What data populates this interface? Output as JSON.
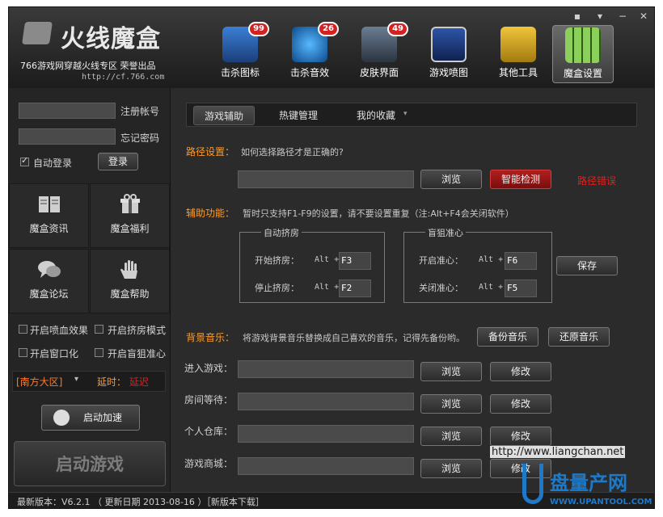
{
  "window": {
    "app_title": "火线魔盒",
    "subtitle": "766游戏网穿越火线专区 荣誉出品",
    "url": "http://cf.766.com"
  },
  "top_nav": [
    {
      "label": "击杀图标",
      "badge": "99",
      "icon": "kill-icon-shield"
    },
    {
      "label": "击杀音效",
      "badge": "26",
      "icon": "music-note-icon"
    },
    {
      "label": "皮肤界面",
      "badge": "49",
      "icon": "skin-character-icon"
    },
    {
      "label": "游戏喷图",
      "badge": "",
      "icon": "spray-mask-icon"
    },
    {
      "label": "其他工具",
      "badge": "",
      "icon": "tools-icon"
    },
    {
      "label": "魔盒设置",
      "badge": "",
      "icon": "settings-grid-icon"
    }
  ],
  "login": {
    "register_link": "注册帐号",
    "forgot_link": "忘记密码",
    "auto_login": "自动登录",
    "login_button": "登录"
  },
  "tiles": [
    {
      "label": "魔盒资讯",
      "icon": "book-icon"
    },
    {
      "label": "魔盒福利",
      "icon": "gift-icon"
    },
    {
      "label": "魔盒论坛",
      "icon": "chat-bubbles-icon"
    },
    {
      "label": "魔盒帮助",
      "icon": "hand-icon"
    }
  ],
  "options": {
    "blood_effect": "开启喷血效果",
    "squeeze_mode": "开启挤房模式",
    "window_mode": "开启窗口化",
    "blind_sniper": "开启盲狙准心"
  },
  "region": {
    "selected": "[南方大区]",
    "latency_label": "延时：",
    "latency_value": "延迟"
  },
  "accelerate_button": "启动加速",
  "start_game_button": "启动游戏",
  "tabs": [
    "游戏辅助",
    "热键管理",
    "我的收藏"
  ],
  "path": {
    "title": "路径设置：",
    "help": "如何选择路径才是正确的?",
    "browse": "浏览",
    "detect": "智能检测",
    "error": "路径错误"
  },
  "assist": {
    "title": "辅助功能：",
    "note": "暂时只支持F1-F9的设置，请不要设置重复（注:Alt+F4会关闭软件）",
    "group_squeeze": "自动挤房",
    "start_squeeze": "开始挤房：",
    "stop_squeeze": "停止挤房：",
    "group_sniper": "盲狙准心",
    "sniper_on": "开启准心：",
    "sniper_off": "关闭准心：",
    "modifier": "Alt +",
    "keys": {
      "start_squeeze": "F3",
      "stop_squeeze": "F2",
      "sniper_on": "F6",
      "sniper_off": "F5"
    },
    "save": "保存"
  },
  "bgm": {
    "title": "背景音乐：",
    "desc": "将游戏背景音乐替换成自己喜欢的音乐，记得先备份哟。",
    "backup": "备份音乐",
    "restore": "还原音乐",
    "rows": [
      {
        "label": "进入游戏："
      },
      {
        "label": "房间等待："
      },
      {
        "label": "个人仓库："
      },
      {
        "label": "游戏商城："
      }
    ],
    "browse": "浏览",
    "modify": "修改"
  },
  "status": {
    "version": "最新版本：V6.2.1 （ 更新日期 2013-08-16 ）［新版本下载］"
  },
  "watermark": {
    "url": "http://www.liangchan.net",
    "brand": "盘量产网",
    "domain": "WWW.UPANTOOL.COM"
  },
  "colors": {
    "accent_orange": "#ff9a2b",
    "error_red": "#e02020",
    "background": "#2a2a2a"
  }
}
